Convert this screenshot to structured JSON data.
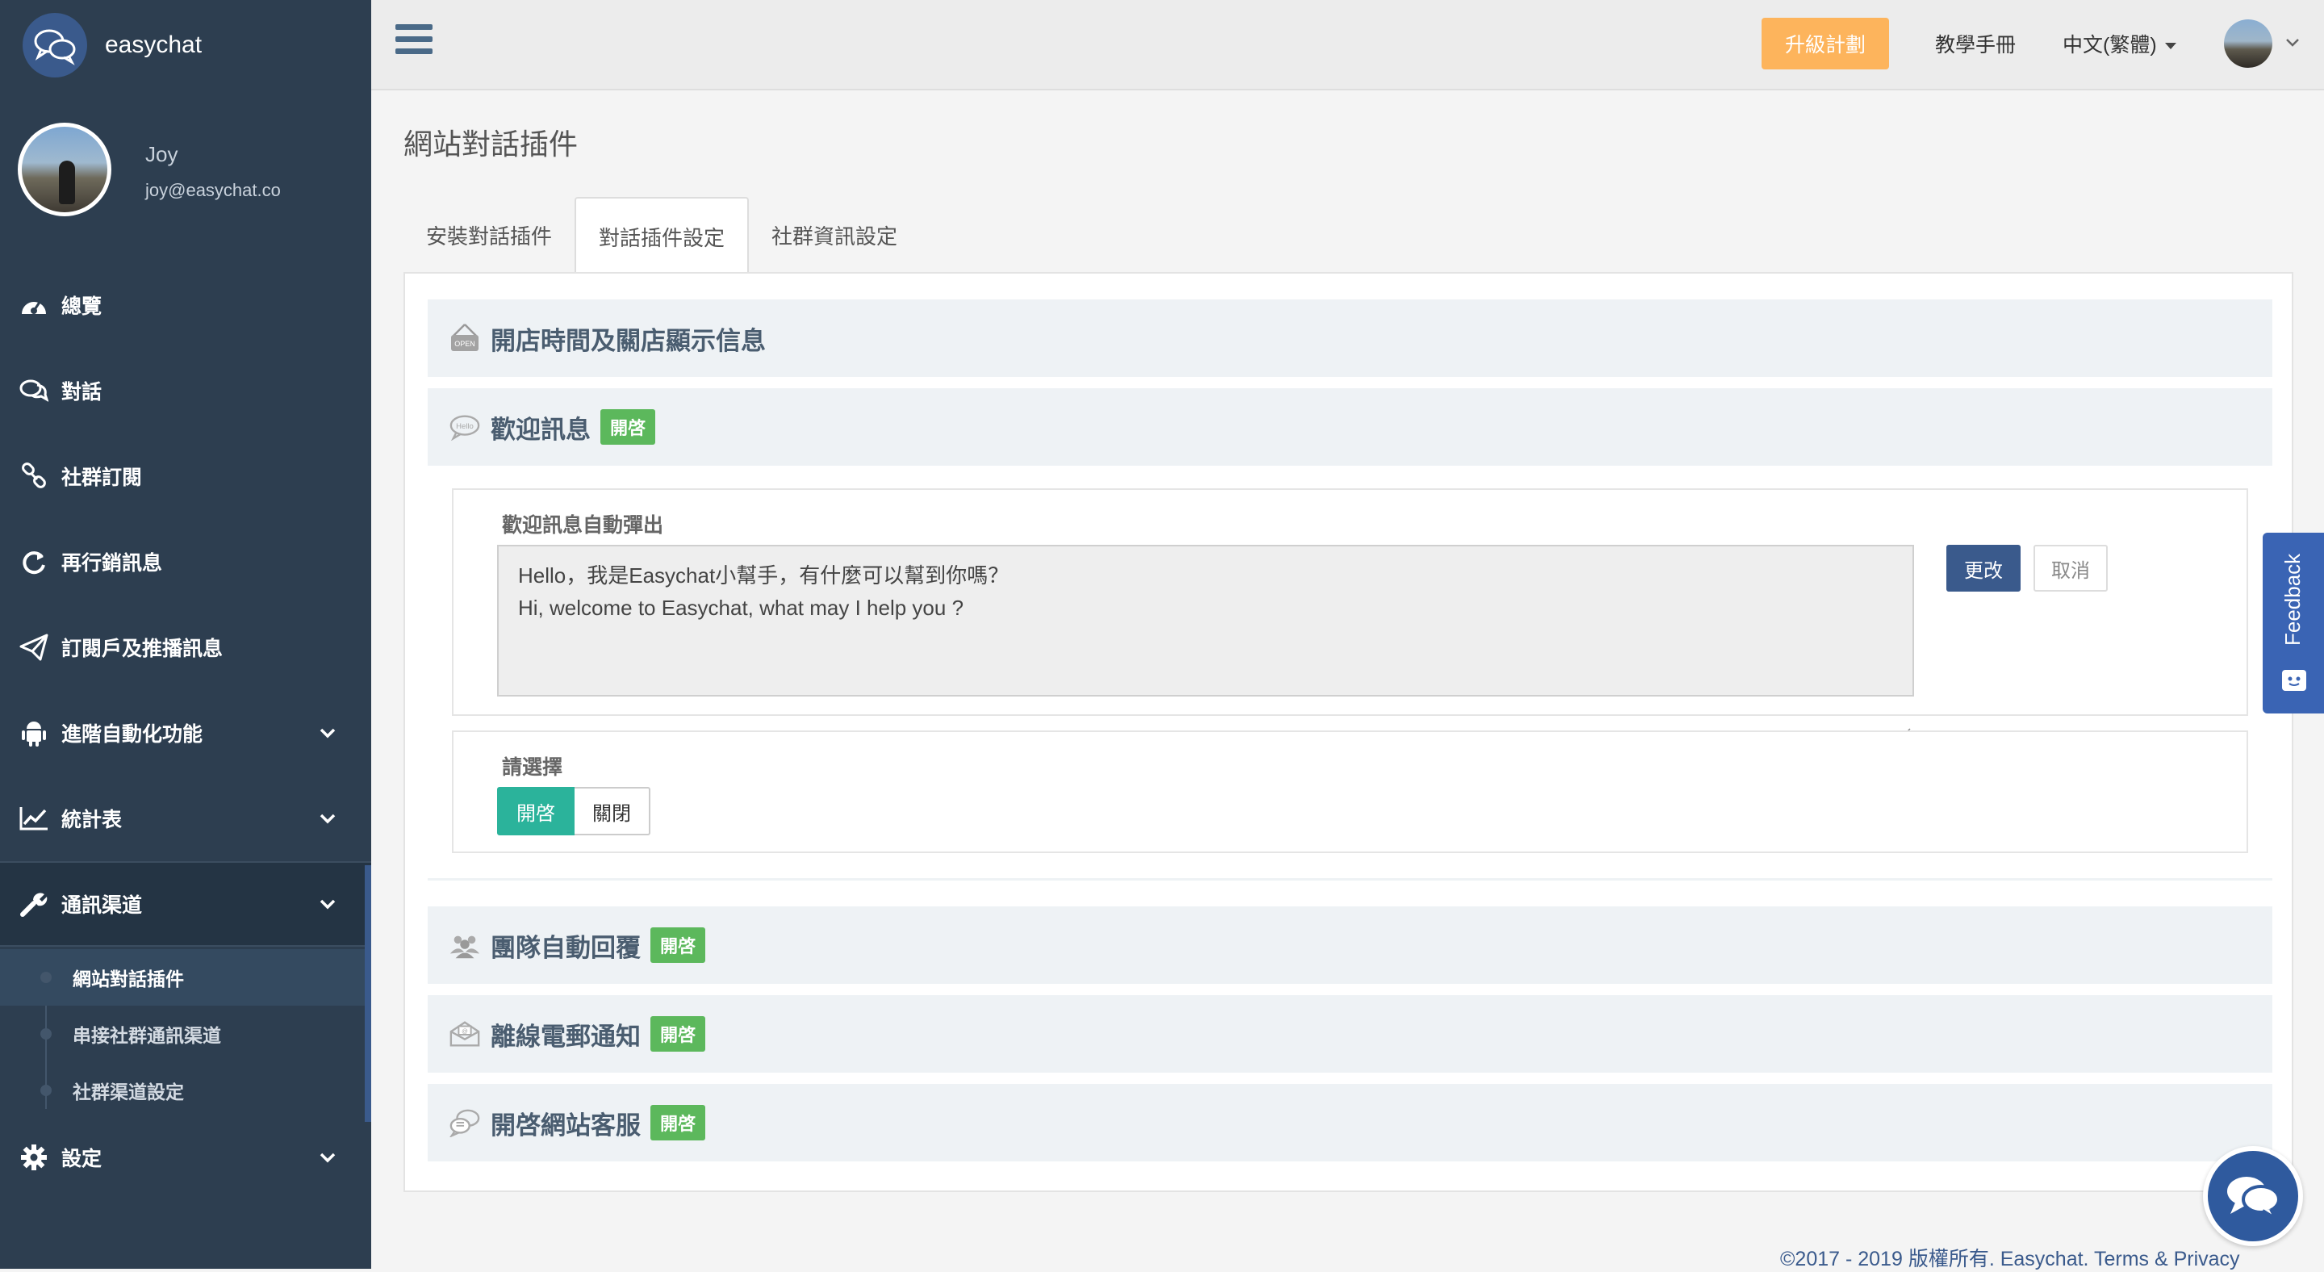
{
  "brand": {
    "name": "easychat"
  },
  "profile": {
    "name": "Joy",
    "email": "joy@easychat.co"
  },
  "nav": [
    {
      "label": "總覽",
      "icon": "dashboard-icon",
      "has_children": false
    },
    {
      "label": "對話",
      "icon": "chat-icon",
      "has_children": false
    },
    {
      "label": "社群訂閱",
      "icon": "link-icon",
      "has_children": false
    },
    {
      "label": "再行銷訊息",
      "icon": "refresh-icon",
      "has_children": false
    },
    {
      "label": "訂閱戶及推播訊息",
      "icon": "send-icon",
      "has_children": false
    },
    {
      "label": "進階自動化功能",
      "icon": "android-icon",
      "has_children": true
    },
    {
      "label": "統計表",
      "icon": "line-chart-icon",
      "has_children": true
    },
    {
      "label": "通訊渠道",
      "icon": "wrench-icon",
      "has_children": true,
      "active": true
    },
    {
      "label": "設定",
      "icon": "gear-icon",
      "has_children": true
    }
  ],
  "subnav": [
    {
      "label": "網站對話插件",
      "current": true
    },
    {
      "label": "串接社群通訊渠道",
      "current": false
    },
    {
      "label": "社群渠道設定",
      "current": false
    }
  ],
  "topbar": {
    "upgrade_label": "升級計劃",
    "manual_label": "教學手冊",
    "language_label": "中文(繁體)"
  },
  "page": {
    "title": "網站對話插件"
  },
  "tabs": [
    {
      "label": "安裝對話插件",
      "active": false
    },
    {
      "label": "對話插件設定",
      "active": true
    },
    {
      "label": "社群資訊設定",
      "active": false
    }
  ],
  "sections": [
    {
      "title": "開店時間及關店顯示信息",
      "icon": "open-sign-icon",
      "badge": ""
    },
    {
      "title": "歡迎訊息",
      "icon": "hello-bubble-icon",
      "badge": "開啓",
      "expanded": true
    },
    {
      "title": "團隊自動回覆",
      "icon": "team-icon",
      "badge": "開啓"
    },
    {
      "title": "離線電郵通知",
      "icon": "envelope-icon",
      "badge": "開啓"
    },
    {
      "title": "開啓網站客服",
      "icon": "chat-bubbles-icon",
      "badge": "開啓"
    }
  ],
  "welcome": {
    "field_label": "歡迎訊息自動彈出",
    "message_line1": "Hello，我是Easychat小幫手，有什麼可以幫到你嗎？",
    "message_line2": "Hi, welcome to Easychat, what may I help you ?",
    "save_label": "更改",
    "cancel_label": "取消",
    "choose_label": "請選擇",
    "toggle_on_label": "開啓",
    "toggle_off_label": "關閉",
    "toggle_state": "on"
  },
  "feedback_label": "Feedback",
  "footer": {
    "text": "©2017 - 2019 版權所有. Easychat. Terms & Privacy"
  },
  "colors": {
    "sidebar_bg": "#2d3e50",
    "primary": "#3a5a8c",
    "upgrade": "#fdb45c",
    "badge_green": "#5cb85c",
    "toggle_on": "#2bb39b",
    "feedback": "#3a64b4"
  }
}
